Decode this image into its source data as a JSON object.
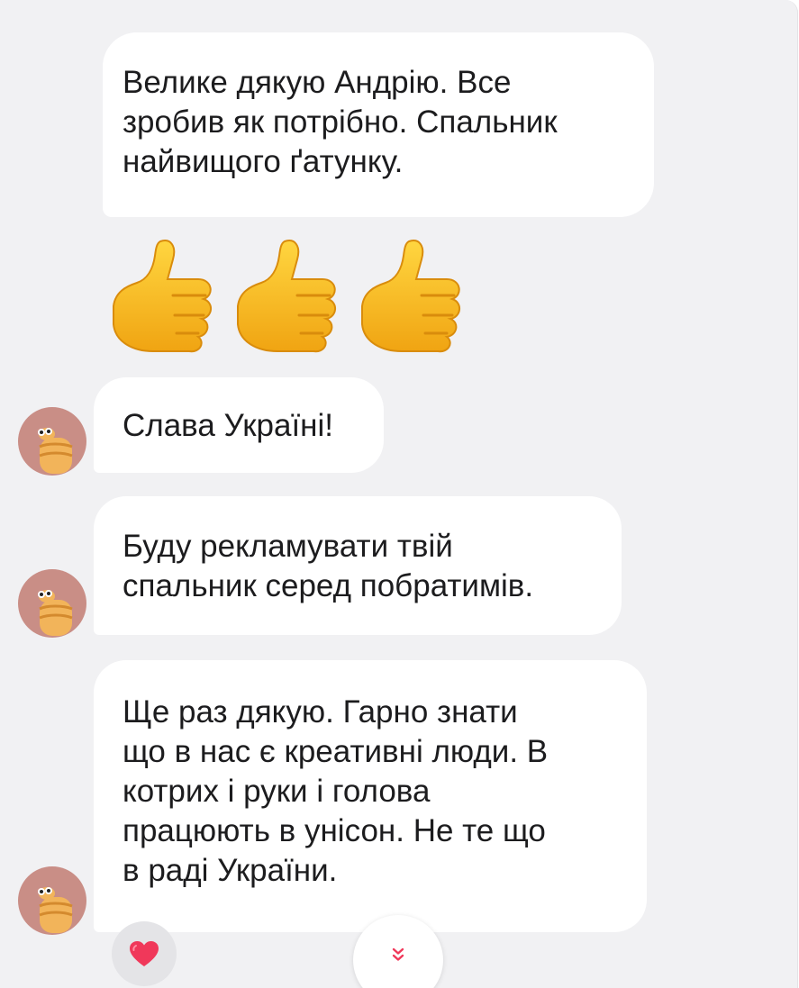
{
  "messages": [
    {
      "text": "Велике дякую Андрію. Все\nзробив як потрібно. Спальник\nнайвищого ґатунку."
    },
    {
      "text": "Слава Україні!"
    },
    {
      "text": "Буду рекламувати твій\nспальник серед побратимів."
    },
    {
      "text": "Ще раз дякую. Гарно знати\nщо в нас є креативні люди. В\nкотрих і руки і голова\nпрацюють в унісон. Не те що\nв раді України."
    }
  ],
  "emoji_message": {
    "icons": [
      "thumbs-up-icon",
      "thumbs-up-icon",
      "thumbs-up-icon"
    ]
  },
  "reaction": {
    "icon": "heart-icon",
    "color": "#f0385a"
  },
  "scroll_button": {
    "icon": "chevron-double-down-icon",
    "color": "#f0385a"
  },
  "colors": {
    "background": "#f1f1f3",
    "bubble": "#ffffff",
    "avatar": "#c98e86",
    "thumb": "#f5c02a"
  }
}
